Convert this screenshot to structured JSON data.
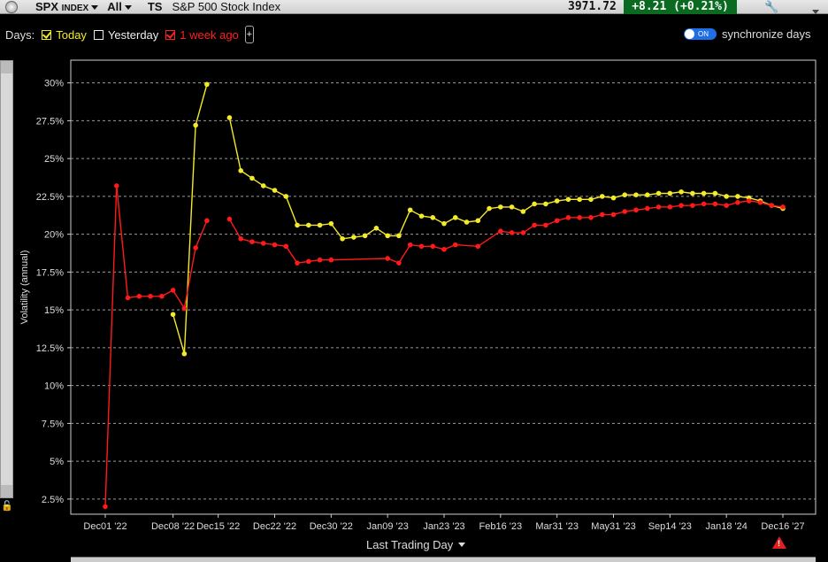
{
  "header": {
    "symbol": "SPX",
    "symbol_suffix": "INDEX",
    "filter": "All",
    "ts_label": "TS",
    "name": "S&P 500 Stock Index",
    "price": "3971.72",
    "change": "+8.21 (+0.21%)",
    "change_color": "#0a6b20"
  },
  "days": {
    "label": "Days:",
    "today": "Today",
    "yesterday": "Yesterday",
    "week_ago": "1 week ago",
    "plus": "+",
    "sync_label": "synchronize days",
    "toggle_text": "ON"
  },
  "chart_data": {
    "type": "line",
    "xlabel": "Last Trading Day",
    "ylabel": "Volatility (annual)",
    "ylim": [
      1.5,
      31.5
    ],
    "y_ticks": [
      2.5,
      5,
      7.5,
      10,
      12.5,
      15,
      17.5,
      20,
      22.5,
      25,
      27.5,
      30
    ],
    "y_tick_labels": [
      "2.5%",
      "5%",
      "7.5%",
      "10%",
      "12.5%",
      "15%",
      "17.5%",
      "20%",
      "22.5%",
      "25%",
      "27.5%",
      "30%"
    ],
    "x_tick_labels": [
      "Dec01 '22",
      "Dec08 '22",
      "Dec15 '22",
      "Dec22 '22",
      "Dec30 '22",
      "Jan09 '23",
      "Jan23 '23",
      "Feb16 '23",
      "Mar31 '23",
      "May31 '23",
      "Sep14 '23",
      "Jan18 '24",
      "Dec16 '27"
    ],
    "x_tick_index": [
      0,
      6,
      10,
      15,
      20,
      25,
      30,
      35,
      40,
      45,
      50,
      55,
      60
    ],
    "x_count": 61,
    "grid": true,
    "series": [
      {
        "name": "Today",
        "color": "#f4ea2a",
        "segments": [
          [
            [
              6,
              14.7
            ],
            [
              7,
              12.1
            ],
            [
              8,
              27.2
            ],
            [
              9,
              29.9
            ]
          ],
          [
            [
              11,
              27.7
            ],
            [
              12,
              24.2
            ],
            [
              13,
              23.7
            ],
            [
              14,
              23.2
            ],
            [
              15,
              22.9
            ],
            [
              16,
              22.5
            ],
            [
              17,
              20.6
            ],
            [
              18,
              20.6
            ],
            [
              19,
              20.6
            ],
            [
              20,
              20.7
            ],
            [
              21,
              19.7
            ],
            [
              22,
              19.8
            ],
            [
              23,
              19.9
            ],
            [
              24,
              20.4
            ],
            [
              25,
              19.9
            ],
            [
              26,
              19.9
            ],
            [
              27,
              21.6
            ],
            [
              28,
              21.2
            ],
            [
              29,
              21.1
            ],
            [
              30,
              20.7
            ],
            [
              31,
              21.1
            ],
            [
              32,
              20.8
            ],
            [
              33,
              20.9
            ],
            [
              34,
              21.7
            ],
            [
              35,
              21.8
            ],
            [
              36,
              21.8
            ],
            [
              37,
              21.5
            ],
            [
              38,
              22.0
            ],
            [
              39,
              22.0
            ],
            [
              40,
              22.2
            ],
            [
              41,
              22.3
            ],
            [
              42,
              22.3
            ],
            [
              43,
              22.3
            ],
            [
              44,
              22.5
            ],
            [
              45,
              22.4
            ],
            [
              46,
              22.6
            ],
            [
              47,
              22.6
            ],
            [
              48,
              22.6
            ],
            [
              49,
              22.7
            ],
            [
              50,
              22.7
            ],
            [
              51,
              22.8
            ],
            [
              52,
              22.7
            ],
            [
              53,
              22.7
            ],
            [
              54,
              22.7
            ],
            [
              55,
              22.5
            ],
            [
              56,
              22.5
            ],
            [
              57,
              22.4
            ],
            [
              58,
              22.2
            ],
            [
              59,
              21.9
            ],
            [
              60,
              21.7
            ]
          ]
        ]
      },
      {
        "name": "1 week ago",
        "color": "#ff1a1a",
        "segments": [
          [
            [
              0,
              2.0
            ],
            [
              1,
              23.2
            ],
            [
              2,
              15.8
            ],
            [
              3,
              15.9
            ],
            [
              4,
              15.9
            ],
            [
              5,
              15.9
            ],
            [
              6,
              16.3
            ],
            [
              7,
              15.1
            ],
            [
              8,
              19.1
            ],
            [
              9,
              20.9
            ]
          ],
          [
            [
              11,
              21.0
            ],
            [
              12,
              19.7
            ],
            [
              13,
              19.5
            ],
            [
              14,
              19.4
            ],
            [
              15,
              19.3
            ],
            [
              16,
              19.2
            ],
            [
              17,
              18.1
            ],
            [
              18,
              18.2
            ],
            [
              19,
              18.3
            ],
            [
              20,
              18.3
            ],
            [
              25,
              18.4
            ],
            [
              26,
              18.1
            ],
            [
              27,
              19.3
            ],
            [
              28,
              19.2
            ],
            [
              29,
              19.2
            ],
            [
              30,
              19.0
            ],
            [
              31,
              19.3
            ],
            [
              33,
              19.2
            ],
            [
              35,
              20.2
            ],
            [
              36,
              20.1
            ],
            [
              37,
              20.1
            ],
            [
              38,
              20.6
            ],
            [
              39,
              20.6
            ],
            [
              40,
              20.9
            ],
            [
              41,
              21.1
            ],
            [
              42,
              21.1
            ],
            [
              43,
              21.1
            ],
            [
              44,
              21.3
            ],
            [
              45,
              21.3
            ],
            [
              46,
              21.5
            ],
            [
              47,
              21.6
            ],
            [
              48,
              21.7
            ],
            [
              49,
              21.8
            ],
            [
              50,
              21.8
            ],
            [
              51,
              21.9
            ],
            [
              52,
              21.9
            ],
            [
              53,
              22.0
            ],
            [
              54,
              22.0
            ],
            [
              55,
              21.9
            ],
            [
              56,
              22.1
            ],
            [
              57,
              22.2
            ],
            [
              58,
              22.1
            ],
            [
              59,
              21.9
            ],
            [
              60,
              21.8
            ]
          ]
        ]
      }
    ]
  }
}
